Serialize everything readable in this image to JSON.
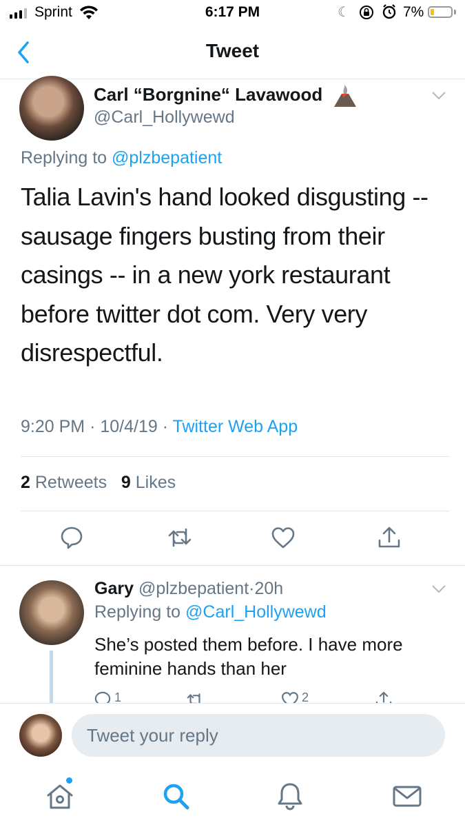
{
  "status_bar": {
    "carrier": "Sprint",
    "time": "6:17 PM",
    "battery_percent": "7%",
    "battery_level": 0.07
  },
  "nav": {
    "title": "Tweet"
  },
  "main_tweet": {
    "author_name": "Carl “Borgnine“ Lavawood",
    "author_handle": "@Carl_Hollywewd",
    "replying_prefix": "Replying to",
    "replying_handle": "@plzbepatient",
    "text": "Talia Lavin's hand looked disgusting -- sausage fingers busting from their casings -- in a new york restaurant before twitter dot com. Very very disrespectful.",
    "time": "9:20 PM",
    "separator": "·",
    "date": "10/4/19",
    "source": "Twitter Web App",
    "retweet_count": "2",
    "retweet_label": "Retweets",
    "like_count": "9",
    "like_label": "Likes"
  },
  "reply_tweet": {
    "author_name": "Gary",
    "author_handle": "@plzbepatient",
    "separator": "·",
    "age": "20h",
    "replying_prefix": "Replying to",
    "replying_handle": "@Carl_Hollywewd",
    "text": "She’s posted them before. I have more feminine hands than her",
    "reply_count": "1",
    "like_count": "2"
  },
  "compose": {
    "placeholder": "Tweet your reply"
  },
  "colors": {
    "accent": "#1da1f2",
    "secondary_text": "#657786",
    "divider": "#e1e8ed",
    "icon_gray": "#657786"
  },
  "icons": {
    "back": "chevron-left-icon",
    "caret": "chevron-down-icon",
    "reply": "speech-bubble-icon",
    "retweet": "retweet-icon",
    "like": "heart-icon",
    "share": "share-icon",
    "home": "home-icon",
    "search": "search-icon",
    "notifications": "bell-icon",
    "messages": "envelope-icon"
  }
}
